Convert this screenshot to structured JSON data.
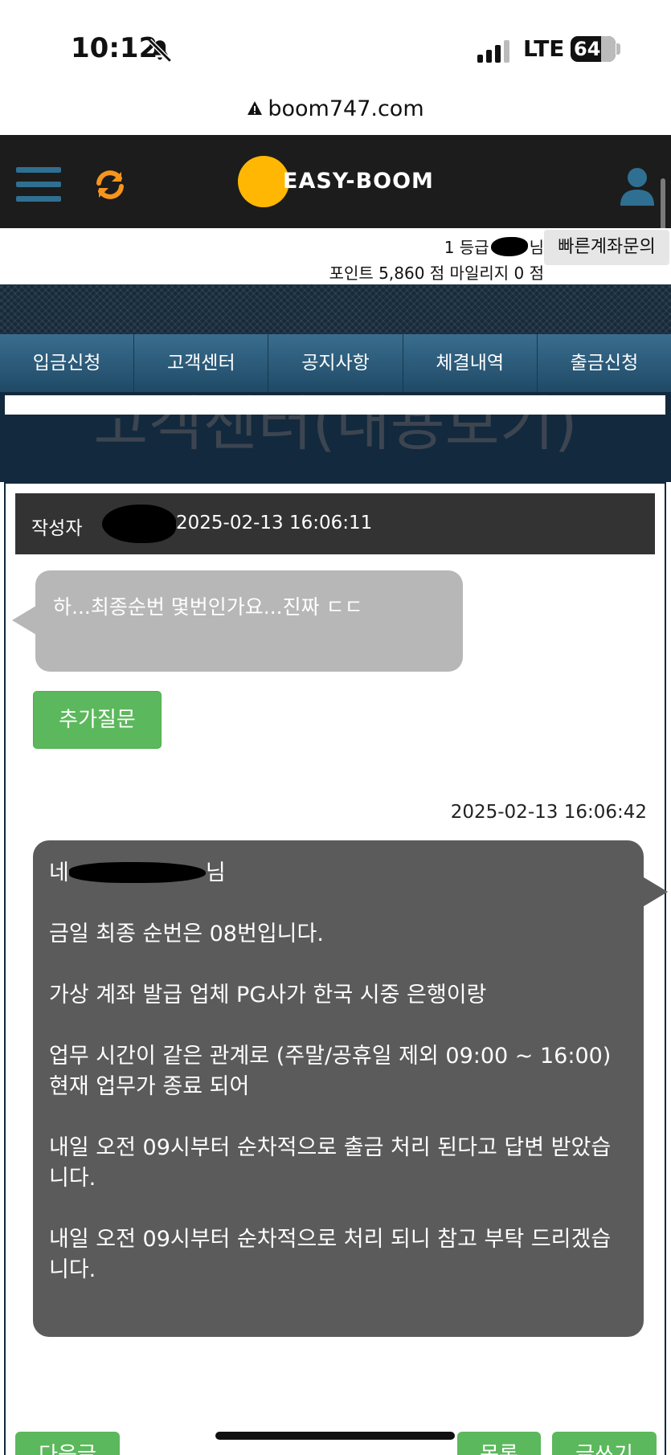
{
  "status_bar": {
    "time": "10:12",
    "network": "LTE",
    "battery": "64"
  },
  "browser": {
    "url": "boom747.com"
  },
  "header": {
    "logo_text": "EASY-BOOM"
  },
  "info": {
    "level_prefix": "1 등급",
    "level_suffix": "님",
    "points": "포인트 5,860 점 마일리지 0 점",
    "quick_account_button": "빠른계좌문의"
  },
  "nav": {
    "tabs": [
      {
        "label": "입금신청"
      },
      {
        "label": "고객센터"
      },
      {
        "label": "공지사항"
      },
      {
        "label": "체결내역"
      },
      {
        "label": "출금신청"
      }
    ]
  },
  "page_title": "고객센터(내용보기)",
  "post": {
    "author_label": "작성자",
    "date": "2025-02-13 16:06:11",
    "question": "하...최종순번 몇번인가요...진짜 ㄷㄷ",
    "followup_button": "추가질문"
  },
  "answer": {
    "date": "2025-02-13 16:06:42",
    "greeting_prefix": "네",
    "greeting_suffix": "님",
    "paragraphs": [
      "금일 최종 순번은 08번입니다.",
      "가상 계좌 발급 업체 PG사가 한국 시중 은행이랑",
      "업무 시간이 같은 관계로 (주말/공휴일 제외 09:00 ~ 16:00) 현재 업무가 종료 되어",
      "내일 오전 09시부터 순차적으로 출금 처리 된다고 답변 받았습니다.",
      "내일 오전 09시부터 순차적으로 처리 되니 참고 부탁 드리겠습니다."
    ]
  },
  "bottom_buttons": {
    "next": "다음글",
    "list": "목록",
    "write": "글쓰기"
  }
}
